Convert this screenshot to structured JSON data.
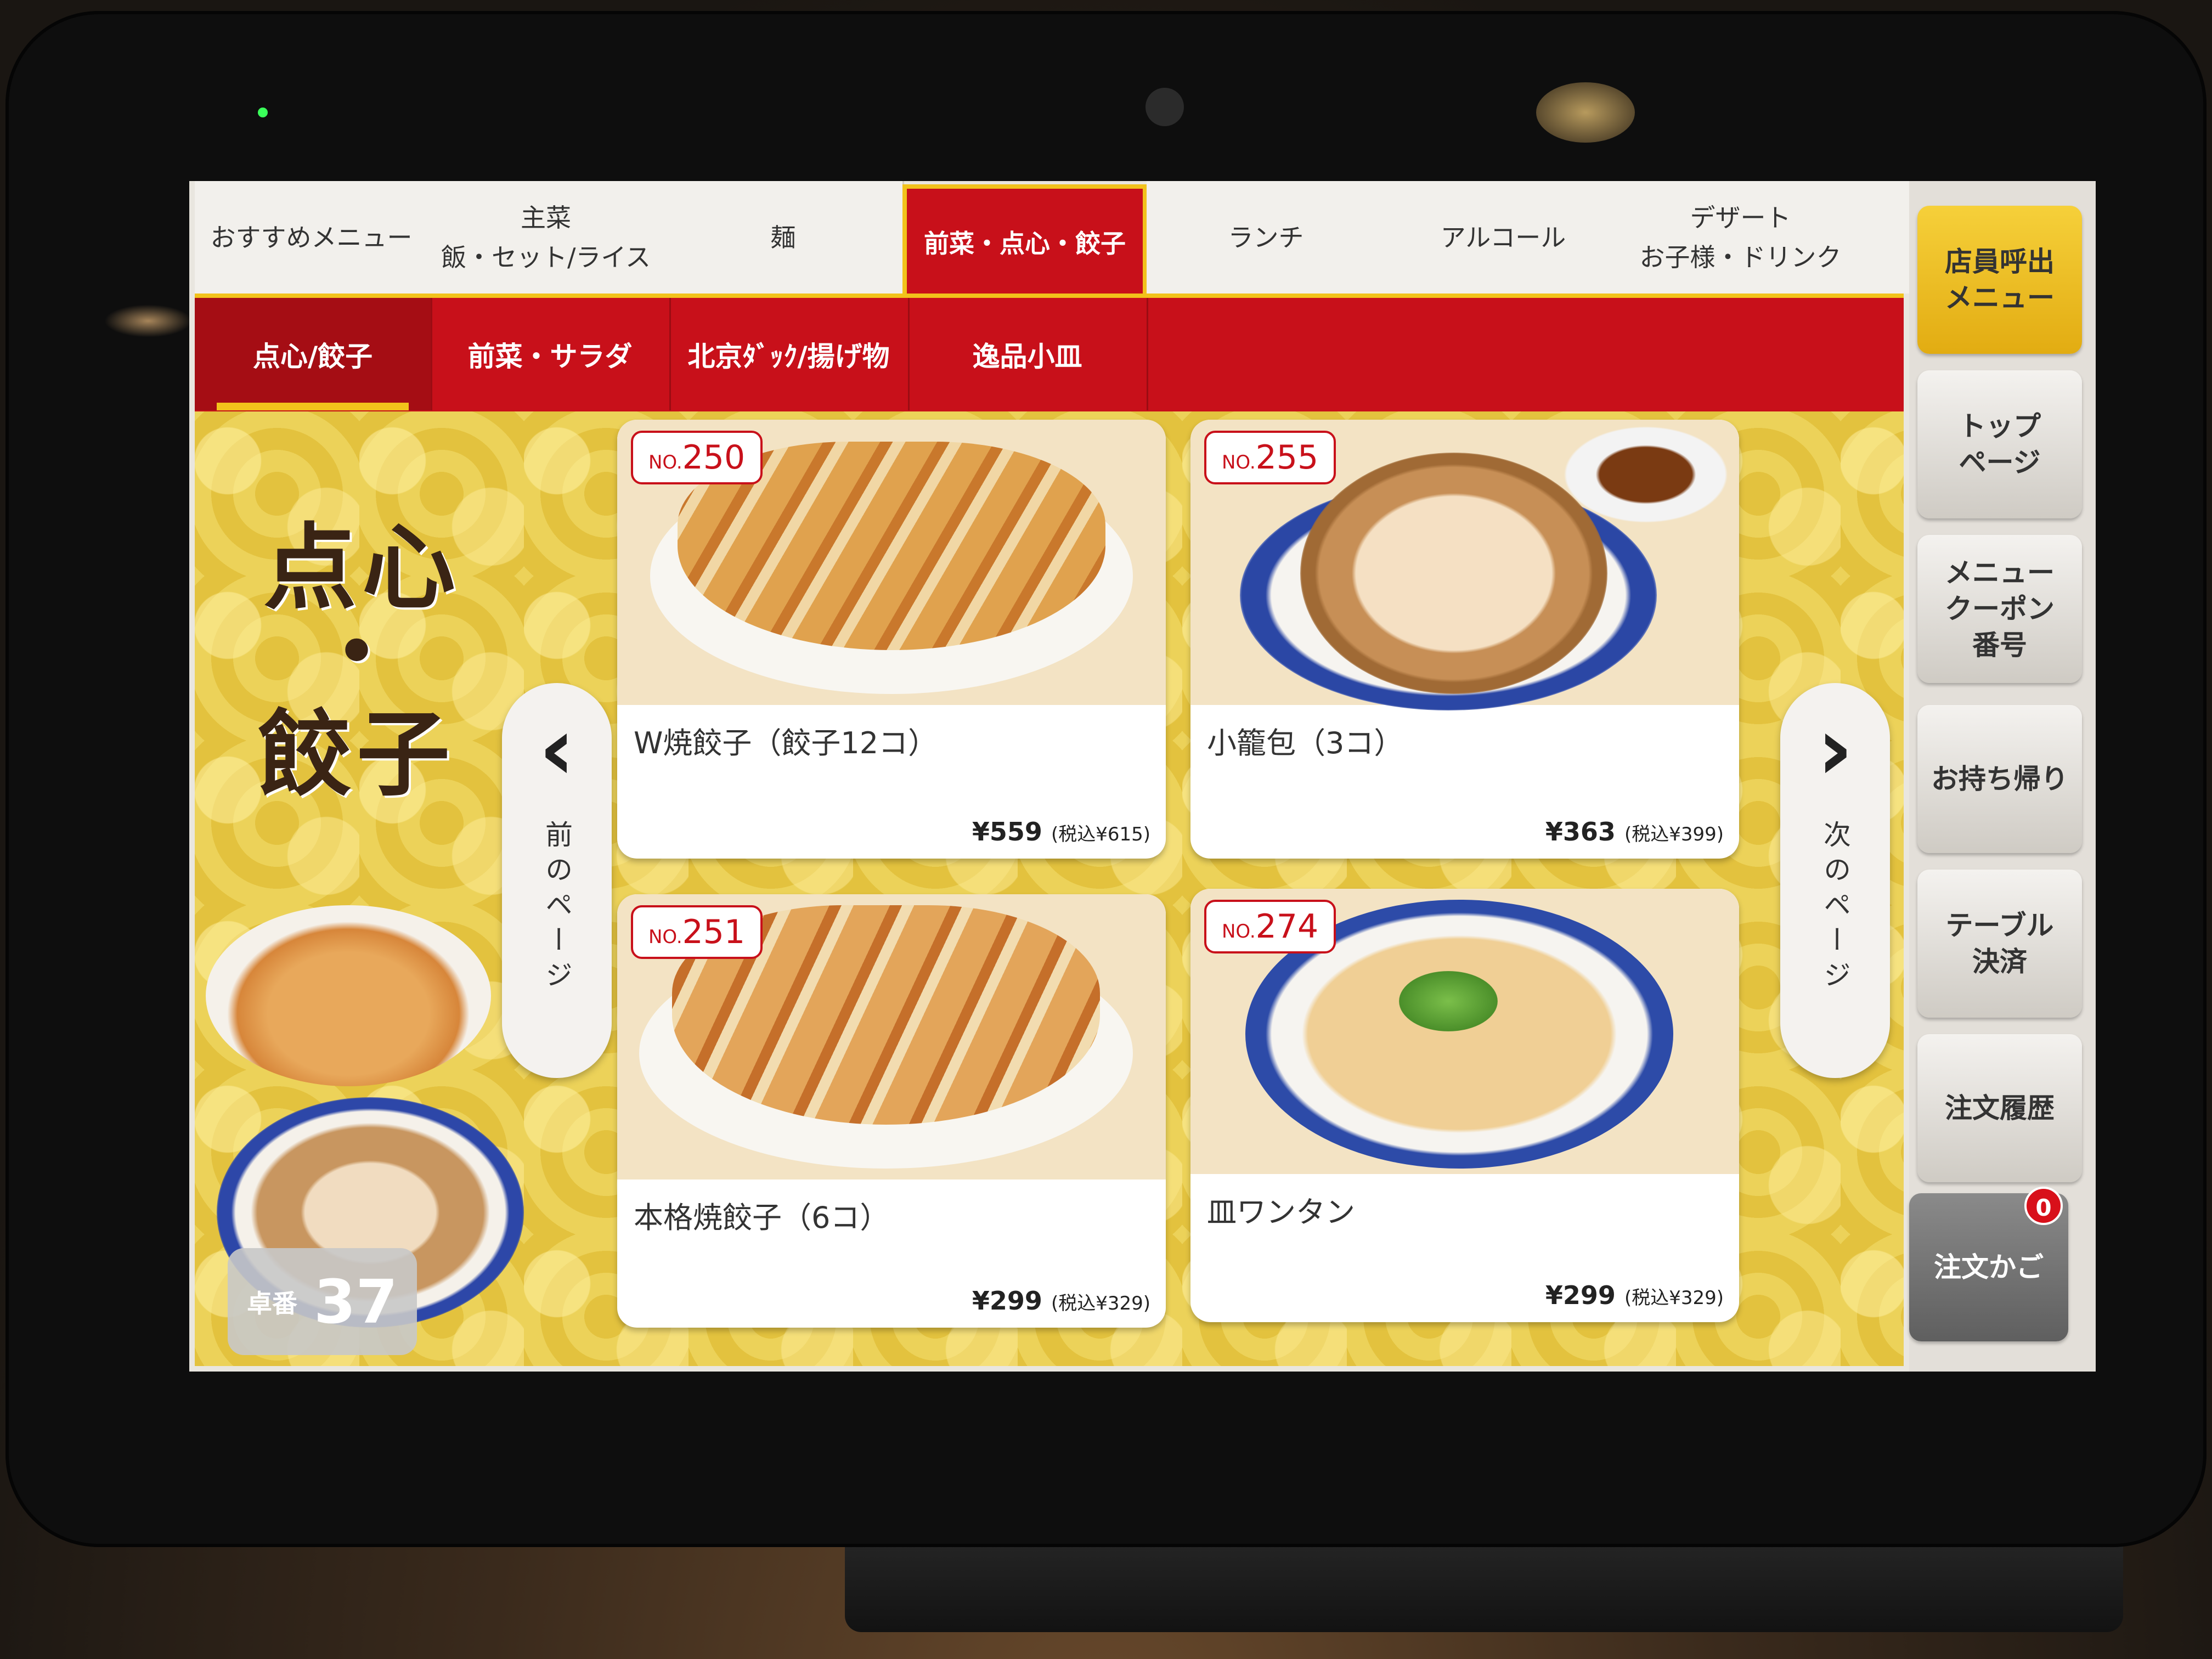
{
  "top_tabs": [
    {
      "line1": "おすすめメニュー",
      "line2": ""
    },
    {
      "line1": "主菜",
      "line2": "飯・セット/ライス"
    },
    {
      "line1": "麺",
      "line2": ""
    },
    {
      "line1": "前菜・点心・餃子",
      "line2": ""
    },
    {
      "line1": "ランチ",
      "line2": ""
    },
    {
      "line1": "アルコール",
      "line2": ""
    },
    {
      "line1": "デザート",
      "line2": "お子様・ドリンク"
    }
  ],
  "sub_tabs": [
    "点心/餃子",
    "前菜・サラダ",
    "北京ﾀﾞｯｸ/揚げ物",
    "逸品小皿"
  ],
  "hero": {
    "line1": "点心",
    "dot": "・",
    "line2": "餃子"
  },
  "table": {
    "label": "卓番",
    "number": "37"
  },
  "nav": {
    "prev": "前のページ",
    "next": "次のページ"
  },
  "items": [
    {
      "no_prefix": "NO.",
      "no": "250",
      "name": "W焼餃子（餃子12コ）",
      "price": "¥559",
      "tax_price": "(税込¥615)"
    },
    {
      "no_prefix": "NO.",
      "no": "255",
      "name": "小籠包（3コ）",
      "price": "¥363",
      "tax_price": "(税込¥399)"
    },
    {
      "no_prefix": "NO.",
      "no": "251",
      "name": "本格焼餃子（6コ）",
      "price": "¥299",
      "tax_price": "(税込¥329)"
    },
    {
      "no_prefix": "NO.",
      "no": "274",
      "name": "皿ワンタン",
      "price": "¥299",
      "tax_price": "(税込¥329)"
    }
  ],
  "sidebar": {
    "call": {
      "line1": "店員呼出",
      "line2": "メニュー"
    },
    "top": {
      "line1": "トップ",
      "line2": "ページ"
    },
    "coupon": {
      "line1": "メニュー",
      "line2": "クーポン",
      "line3": "番号"
    },
    "takeout": "お持ち帰り",
    "pay": {
      "line1": "テーブル",
      "line2": "決済"
    },
    "history": "注文履歴",
    "cart": {
      "label": "注文かご",
      "count": "0"
    }
  },
  "colors": {
    "brand_red": "#c8101a",
    "accent_gold": "#f2c21b",
    "panel_yellow": "#e3c23e"
  }
}
